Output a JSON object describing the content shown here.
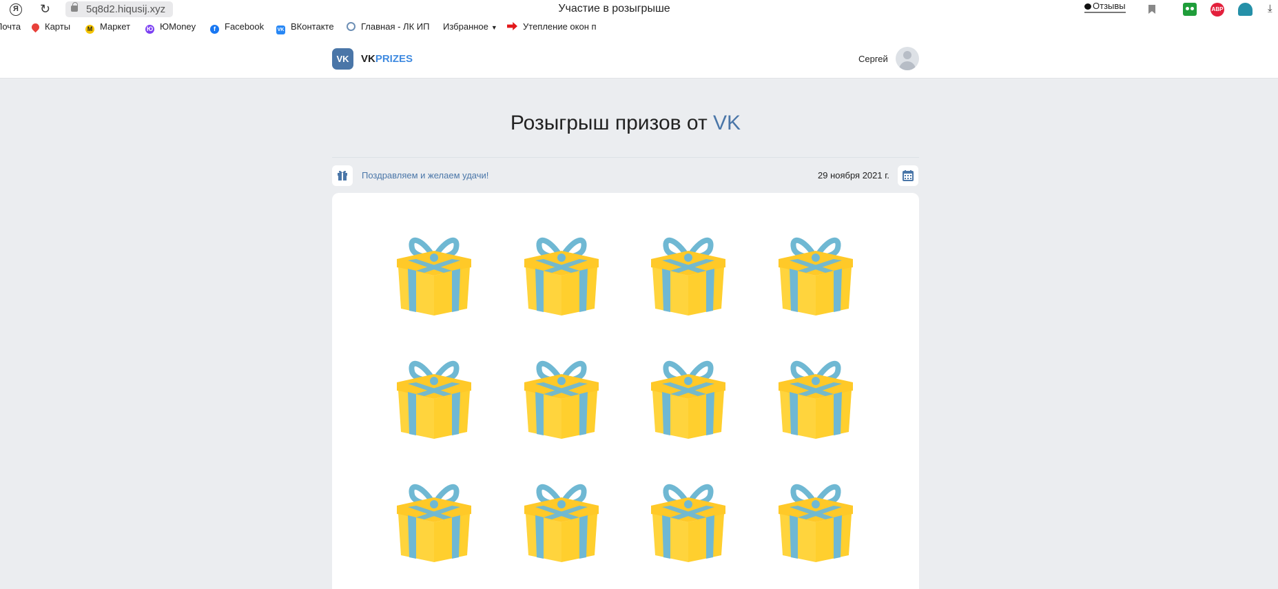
{
  "browser": {
    "url": "5q8d2.hiqusij.xyz",
    "tab_title": "Участие в розыгрыше",
    "reviews_label": "Отзывы",
    "abp_label": "ABP"
  },
  "bookmarks": [
    {
      "label": "Почта",
      "icon": "mail-icon",
      "color": ""
    },
    {
      "label": "Карты",
      "icon": "maps-pin-icon",
      "color": "#e8413a"
    },
    {
      "label": "Маркет",
      "icon": "market-icon",
      "color": "#f5c400"
    },
    {
      "label": "ЮMoney",
      "icon": "yumoney-icon",
      "color": "#7b3ff2"
    },
    {
      "label": "Facebook",
      "icon": "facebook-icon",
      "color": "#1877f2"
    },
    {
      "label": "ВКонтакте",
      "icon": "vk-icon",
      "color": "#2787f5"
    },
    {
      "label": "Главная - ЛК ИП",
      "icon": "tax-service-icon",
      "color": "#6d8fb5"
    },
    {
      "label": "Избранное",
      "icon": "caret-down-icon",
      "color": ""
    },
    {
      "label": "Утепление окон п",
      "icon": "red-arrow-icon",
      "color": "#e2191b"
    }
  ],
  "site": {
    "logo_mark": "VK",
    "logo_vk": "VK",
    "logo_prizes": "PRIZES",
    "user_name": "Сергей"
  },
  "main": {
    "title_prefix": "Розыгрыш призов от ",
    "title_brand": "VK",
    "greeting": "Поздравляем и желаем удачи!",
    "date": "29 ноября 2021 г."
  },
  "gifts": {
    "count": 12,
    "columns": 4,
    "box_color": "#ffd43d",
    "ribbon_color": "#6fb8d3"
  },
  "colors": {
    "accent": "#4a76a8",
    "brand_blue": "#3f8ae0",
    "background": "#ebedf0"
  }
}
